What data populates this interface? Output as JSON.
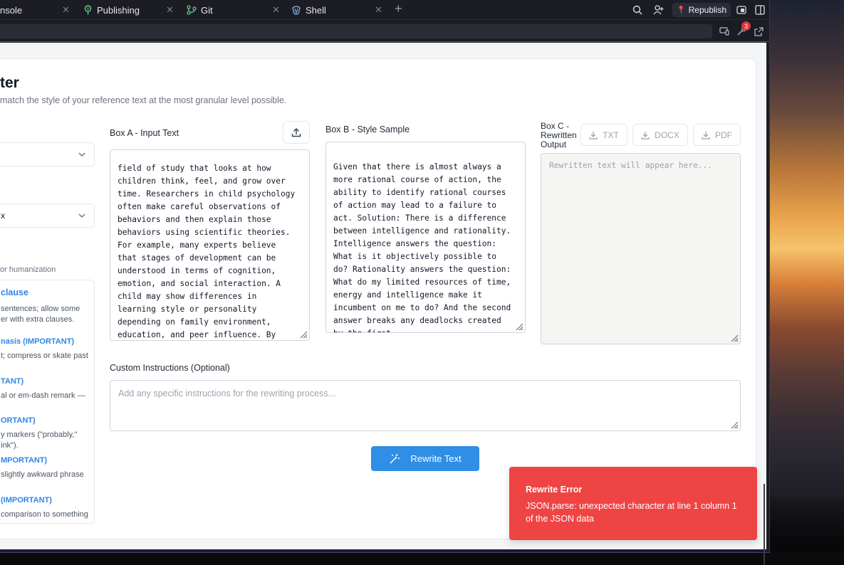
{
  "tabs": [
    {
      "label": "nsole",
      "icon": "console-icon"
    },
    {
      "label": "Publishing",
      "icon": "publishing-icon"
    },
    {
      "label": "Git",
      "icon": "git-icon"
    },
    {
      "label": "Shell",
      "icon": "shell-icon"
    }
  ],
  "toolbar": {
    "republish_label": "Republish",
    "notification_count": "3"
  },
  "page": {
    "title": "ter",
    "subtitle": "match the style of your reference text at the most granular level possible."
  },
  "settings": {
    "select1_value": "",
    "select2_value": "x",
    "hint": "or humanization",
    "style_items": [
      {
        "title": "clause",
        "desc": [
          " sentences; allow some",
          "er with extra clauses."
        ]
      },
      {
        "title": "nasis (IMPORTANT)",
        "desc": [
          "t; compress or skate past"
        ]
      },
      {
        "title": "TANT)",
        "desc": [
          "al or em-dash remark —"
        ]
      },
      {
        "title": "ORTANT)",
        "desc": [
          "y markers (\"probably,\"",
          "ink\")."
        ]
      },
      {
        "title": "MPORTANT)",
        "desc": [
          "slightly awkward phrase"
        ]
      },
      {
        "title": " (IMPORTANT)",
        "desc": [
          "comparison to something"
        ]
      }
    ]
  },
  "box_a": {
    "label": "Box A - Input Text",
    "text": "field of study that looks at how\nchildren think, feel, and grow over\ntime. Researchers in child psychology\noften make careful observations of\nbehaviors and then explain those\nbehaviors using scientific theories.\nFor example, many experts believe\nthat stages of development can be\nunderstood in terms of cognition,\nemotion, and social interaction. A\nchild may show differences in\nlearning style or personality\ndepending on family environment,\neducation, and peer influence. By\nanalyzing these factors, child"
  },
  "box_b": {
    "label": "Box B - Style Sample",
    "text": "Given that there is almost always a\nmore rational course of action, the\nability to identify rational courses\nof action may lead to a failure to\nact. Solution: There is a difference\nbetween intelligence and rationality.\nIntelligence answers the question:\nWhat is it objectively possible to\ndo? Rationality answers the question:\nWhat do my limited resources of time,\nenergy and intelligence make it\nincumbent on me to do? And the second\nanswer breaks any deadlocks created\nby the first."
  },
  "box_c": {
    "label_lines": [
      "Box C -",
      "Rewritten",
      "Output"
    ],
    "placeholder": "Rewritten text will appear here...",
    "export_buttons": [
      "TXT",
      "DOCX",
      "PDF"
    ]
  },
  "custom": {
    "label": "Custom Instructions (Optional)",
    "placeholder": "Add any specific instructions for the rewriting process..."
  },
  "rewrite_button": "Rewrite Text",
  "toast": {
    "title": "Rewrite Error",
    "message": "JSON.parse: unexpected character at line 1 column 1 of the JSON data"
  },
  "colors": {
    "accent": "#2f8ee5",
    "error": "#ef4444",
    "style_title": "#2f86e6"
  }
}
